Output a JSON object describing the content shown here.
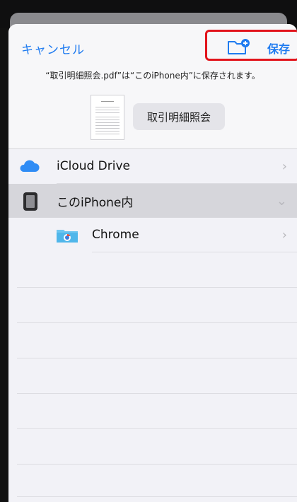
{
  "header": {
    "cancel_label": "キャンセル",
    "save_label": "保存",
    "message": "“取引明細照会.pdf”は“このiPhone内”に保存されます。",
    "file_name": "取引明細照会"
  },
  "locations": [
    {
      "label": "iCloud Drive",
      "icon": "icloud-icon",
      "chevron": "›"
    },
    {
      "label": "このiPhone内",
      "icon": "iphone-icon",
      "chevron": "⌄"
    },
    {
      "label": "Chrome",
      "icon": "chrome-folder-icon",
      "chevron": "›"
    }
  ],
  "colors": {
    "accent": "#1f7bf0",
    "highlight": "#e2141c",
    "selected_row": "#d6d6db"
  }
}
